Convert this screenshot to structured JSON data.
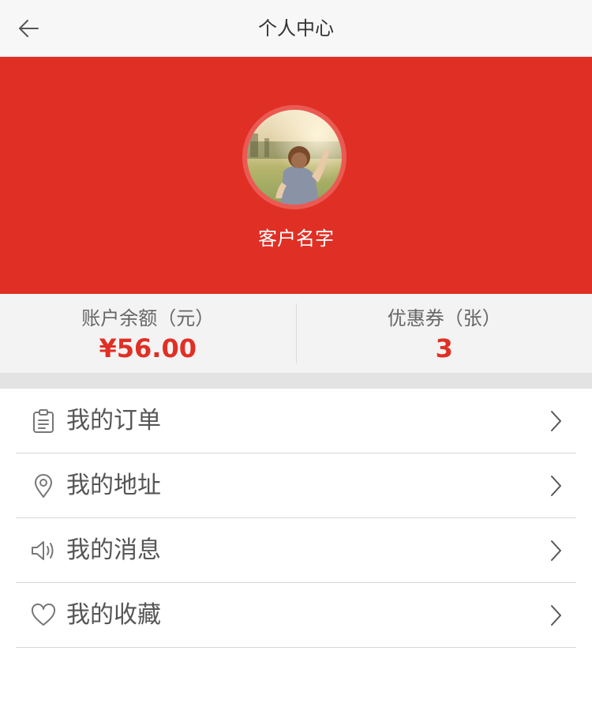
{
  "header": {
    "title": "个人中心",
    "back_icon": "arrow-left-icon"
  },
  "profile": {
    "name": "客户名字",
    "avatar_description": "photo-avatar",
    "banner_color": "#e02f24"
  },
  "stats": {
    "balance": {
      "label": "账户余额（元）",
      "value": "¥56.00"
    },
    "coupons": {
      "label": "优惠券（张）",
      "value": "3"
    },
    "value_color": "#e02f24"
  },
  "menu": {
    "items": [
      {
        "label": "我的订单",
        "icon": "clipboard-icon"
      },
      {
        "label": "我的地址",
        "icon": "location-pin-icon"
      },
      {
        "label": "我的消息",
        "icon": "speaker-icon"
      },
      {
        "label": "我的收藏",
        "icon": "heart-icon"
      }
    ],
    "chevron_icon": "chevron-right-icon"
  }
}
